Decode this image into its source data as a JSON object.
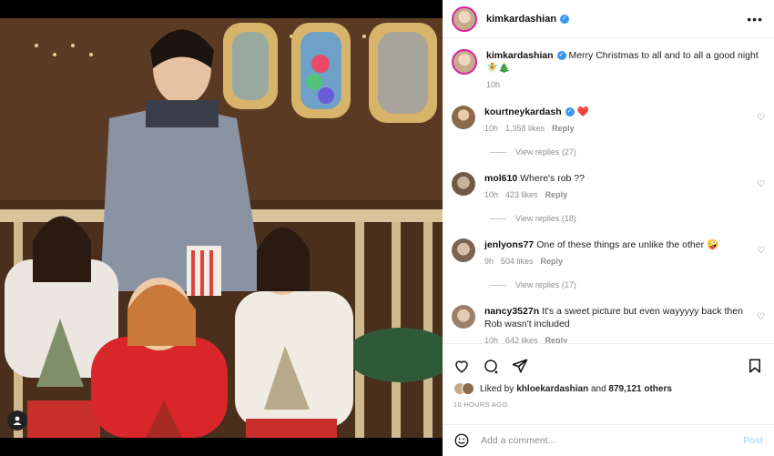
{
  "post": {
    "username": "kimkardashian",
    "more_label": "•••"
  },
  "caption": {
    "username": "kimkardashian",
    "text": "Merry Christmas to all and to all a good night",
    "emoji": "🧚🎄",
    "time": "10h"
  },
  "comments": [
    {
      "username": "kourtneykardash",
      "text": "",
      "emoji": "❤️",
      "time": "10h",
      "likes": "1,358 likes",
      "reply": "Reply",
      "view_replies": "View replies (27)",
      "verified": true
    },
    {
      "username": "mol610",
      "text": "Where's rob ??",
      "time": "10h",
      "likes": "423 likes",
      "reply": "Reply",
      "view_replies": "View replies (18)"
    },
    {
      "username": "jenlyons77",
      "text": "One of these things are unlike the other 🤪",
      "time": "9h",
      "likes": "504 likes",
      "reply": "Reply",
      "view_replies": "View replies (17)"
    },
    {
      "username": "nancy3527n",
      "text": "It's a sweet picture but even wayyyyy back then Rob wasn't included",
      "time": "10h",
      "likes": "642 likes",
      "reply": "Reply"
    }
  ],
  "liked_by": {
    "prefix": "Liked by ",
    "user": "khloekardashian",
    "mid": " and ",
    "count": "879,121 others"
  },
  "timestamp": "10 HOURS AGO",
  "add_comment": {
    "placeholder": "Add a comment...",
    "post_label": "Post"
  }
}
